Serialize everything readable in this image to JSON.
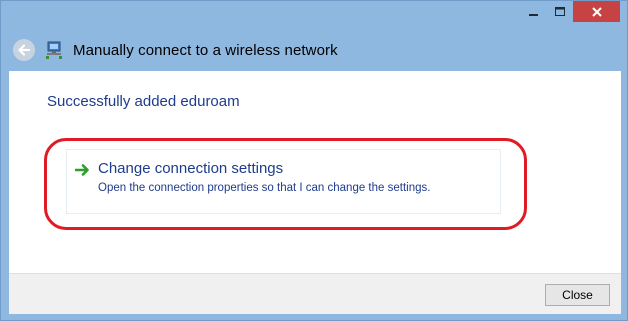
{
  "window": {
    "title": "Manually connect to a wireless network",
    "controls": {
      "minimize_icon": "minimize-icon",
      "maximize_icon": "maximize-icon",
      "close_icon": "close-icon"
    }
  },
  "header": {
    "back_icon": "back-arrow-icon",
    "network_icon": "wireless-network-icon"
  },
  "content": {
    "heading": "Successfully added eduroam",
    "option": {
      "icon": "green-arrow-icon",
      "title": "Change connection settings",
      "description": "Open the connection properties so that I can change the settings."
    },
    "annotation": {
      "color": "#e01b24",
      "shape": "rounded-rectangle"
    }
  },
  "footer": {
    "close_label": "Close"
  },
  "colors": {
    "frame": "#8fb8e0",
    "link_text": "#1e3c8c",
    "close_button_red": "#c74343",
    "arrow_green": "#2e9e2e"
  }
}
